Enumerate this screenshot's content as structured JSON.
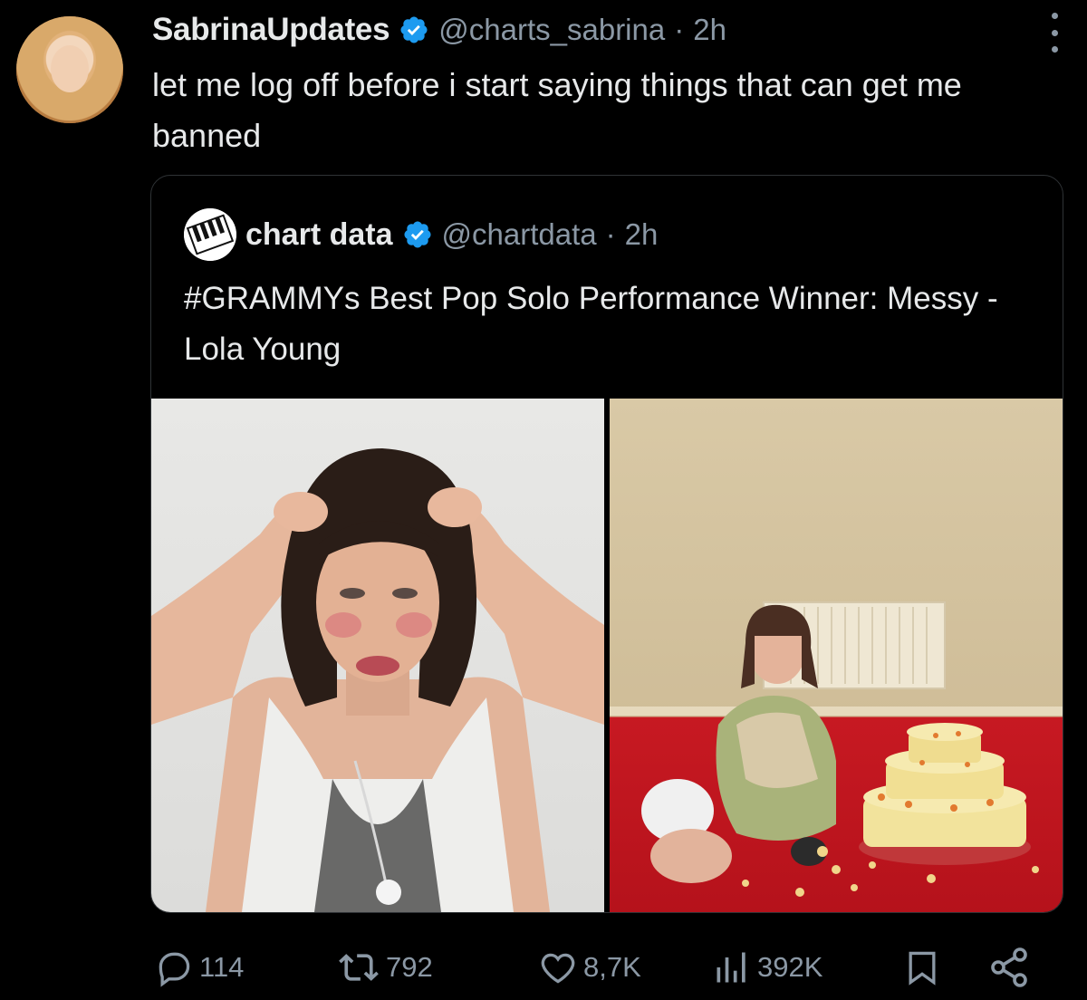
{
  "tweet": {
    "author": {
      "display_name": "SabrinaUpdates",
      "handle": "@charts_sabrina",
      "separator": "·",
      "time": "2h",
      "verified": true
    },
    "text": "let me log off before i start saying things that can get me banned",
    "quoted": {
      "author": {
        "display_name": "chart data",
        "handle": "@chartdata",
        "separator": "·",
        "time": "2h",
        "verified": true
      },
      "text": "#GRAMMYs Best Pop Solo Performance Winner: Messy - Lola Young"
    },
    "actions": {
      "replies": "114",
      "reposts": "792",
      "likes": "8,7K",
      "views": "392K"
    }
  },
  "colors": {
    "background": "#000000",
    "text": "#e7e9ea",
    "secondary": "#8b98a5",
    "verified": "#1d9bf0",
    "border": "#2f3336"
  },
  "icons": {
    "verified": "verified-badge-icon",
    "more": "more-vertical-icon",
    "reply": "reply-icon",
    "repost": "repost-icon",
    "like": "heart-icon",
    "views": "views-chart-icon",
    "bookmark": "bookmark-icon",
    "share": "share-icon"
  }
}
